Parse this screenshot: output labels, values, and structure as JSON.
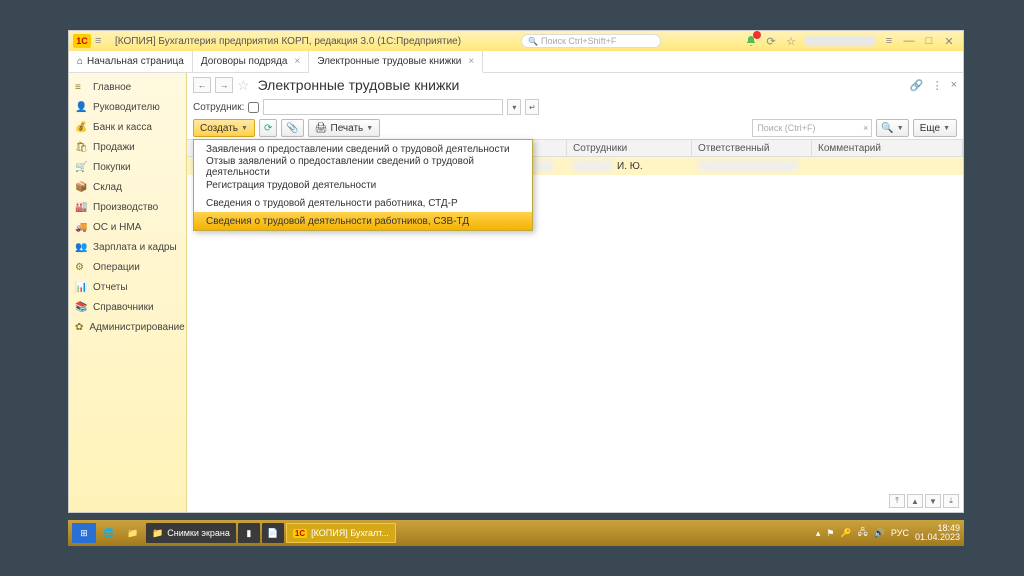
{
  "titlebar": {
    "logo": "1C",
    "title": "[КОПИЯ] Бухгалтерия предприятия КОРП, редакция 3.0  (1C:Предприятие)",
    "search_placeholder": "Поиск Ctrl+Shift+F"
  },
  "tabs": {
    "home": "Начальная страница",
    "t1": "Договоры подряда",
    "t2": "Электронные трудовые книжки"
  },
  "sidebar": [
    {
      "icon": "≡",
      "label": "Главное"
    },
    {
      "icon": "👤",
      "label": "Руководителю"
    },
    {
      "icon": "💰",
      "label": "Банк и касса"
    },
    {
      "icon": "🛍",
      "label": "Продажи"
    },
    {
      "icon": "🛒",
      "label": "Покупки"
    },
    {
      "icon": "📦",
      "label": "Склад"
    },
    {
      "icon": "🏭",
      "label": "Производство"
    },
    {
      "icon": "🚚",
      "label": "ОС и НМА"
    },
    {
      "icon": "👥",
      "label": "Зарплата и кадры"
    },
    {
      "icon": "⚙",
      "label": "Операции"
    },
    {
      "icon": "📊",
      "label": "Отчеты"
    },
    {
      "icon": "📚",
      "label": "Справочники"
    },
    {
      "icon": "✿",
      "label": "Администрирование"
    }
  ],
  "page": {
    "title": "Электронные трудовые книжки",
    "filter_label": "Сотрудник:",
    "create": "Создать",
    "print": "Печать",
    "more": "Еще",
    "search_placeholder": "Поиск (Ctrl+F)"
  },
  "dropdown": [
    "Заявления о предоставлении сведений о трудовой деятельности",
    "Отзыв заявлений о предоставлении сведений о трудовой деятельности",
    "Регистрация трудовой деятельности",
    "Сведения о трудовой деятельности работника, СТД-Р",
    "Сведения о трудовой деятельности работников, СЗВ-ТД"
  ],
  "columns": {
    "c1": "",
    "c2": "Сотрудники",
    "c3": "Ответственный",
    "c4": "Комментарий"
  },
  "row0": {
    "emp": "И. Ю."
  },
  "taskbar": {
    "snip": "Снимки экрана",
    "app": "[КОПИЯ] Бухгалт...",
    "lang": "РУС",
    "time": "18:49",
    "date": "01.04.2023"
  }
}
